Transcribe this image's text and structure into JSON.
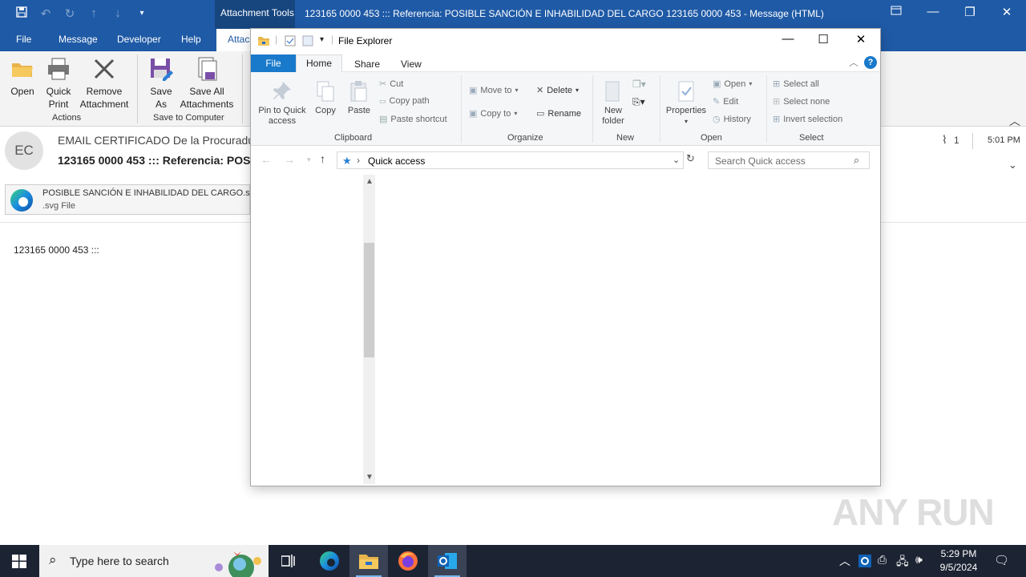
{
  "outlook": {
    "titlebar": {
      "attachment_tools": "Attachment Tools",
      "title": "123165 0000 453 ::: Referencia: POSIBLE SANCIÓN E INHABILIDAD DEL CARGO 123165 0000 453  -  Message (HTML)"
    },
    "tabs": [
      "File",
      "Message",
      "Developer",
      "Help",
      "Attac"
    ],
    "ribbon": {
      "open": "Open",
      "quick_print_1": "Quick",
      "quick_print_2": "Print",
      "remove_1": "Remove",
      "remove_2": "Attachment",
      "actions_group": "Actions",
      "save_as_1": "Save",
      "save_as_2": "As",
      "save_all_1": "Save All",
      "save_all_2": "Attachments",
      "save_group": "Save to Computer"
    },
    "message": {
      "avatar_initials": "EC",
      "from": "EMAIL CERTIFICADO De la Procuradu",
      "subject": "123165 0000 453 ::: Referencia: POSI",
      "attachment_name": "POSIBLE SANCIÓN  E INHABILIDAD DEL CARGO.s",
      "attachment_type": ".svg File",
      "attachment_count": "1",
      "time": "5:01 PM",
      "body": "123165  0000  453  :::"
    }
  },
  "explorer": {
    "title": "File Explorer",
    "tabs": {
      "file": "File",
      "home": "Home",
      "share": "Share",
      "view": "View"
    },
    "clipboard": {
      "pin_1": "Pin to Quick",
      "pin_2": "access",
      "copy": "Copy",
      "paste": "Paste",
      "cut": "Cut",
      "copy_path": "Copy path",
      "paste_shortcut": "Paste shortcut",
      "label": "Clipboard"
    },
    "organize": {
      "move_to": "Move to",
      "copy_to": "Copy to",
      "delete": "Delete",
      "rename": "Rename",
      "label": "Organize"
    },
    "new": {
      "new_folder_1": "New",
      "new_folder_2": "folder",
      "label": "New"
    },
    "open": {
      "properties": "Properties",
      "open": "Open",
      "edit": "Edit",
      "history": "History",
      "label": "Open"
    },
    "select": {
      "select_all": "Select all",
      "select_none": "Select none",
      "invert": "Invert selection",
      "label": "Select"
    },
    "address": {
      "location": "Quick access"
    },
    "search": {
      "placeholder": "Search Quick access"
    }
  },
  "watermark": "ANY RUN",
  "taskbar": {
    "search_placeholder": "Type here to search",
    "time": "5:29 PM",
    "date": "9/5/2024"
  },
  "colors": {
    "outlook_blue": "#1f5aa6",
    "explorer_file_tab": "#1979ca",
    "taskbar": "#1c2433"
  }
}
